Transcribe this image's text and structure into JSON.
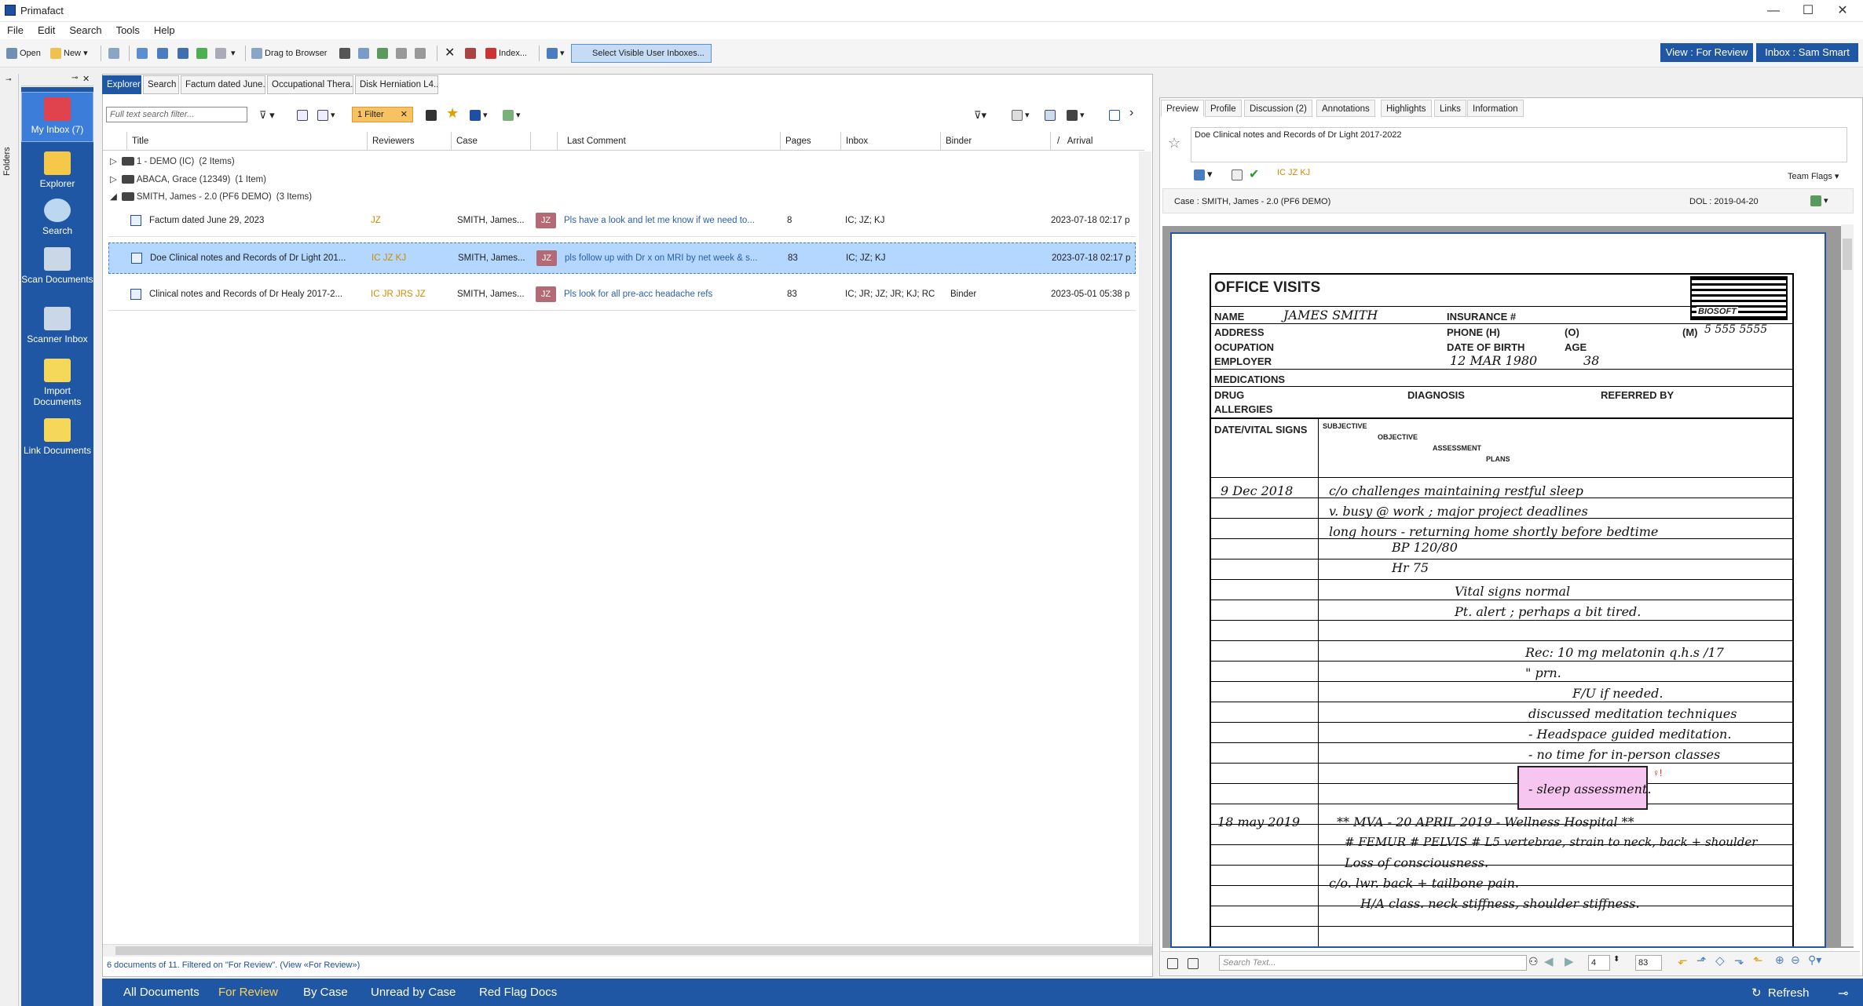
{
  "window": {
    "title": "Primafact",
    "min": "—",
    "max": "☐",
    "close": "✕"
  },
  "menu": [
    "File",
    "Edit",
    "Search",
    "Tools",
    "Help"
  ],
  "toolbar": {
    "open": "Open",
    "new": "New",
    "drag_to_browser": "Drag to Browser",
    "index": "Index...",
    "select_visible": "Select Visible User Inboxes..."
  },
  "header_buttons": {
    "view": "View : For Review",
    "inbox": "Inbox : Sam Smart"
  },
  "folders_label": "Folders",
  "nav": [
    {
      "label": "My Inbox (7)",
      "icon": "inbox-icon",
      "color": "#e0424e"
    },
    {
      "label": "Explorer",
      "icon": "folder-icon",
      "color": "#f5c84a"
    },
    {
      "label": "Search",
      "icon": "search-icon",
      "color": "#bcd7f0"
    },
    {
      "label": "Scan Documents",
      "icon": "scanner-icon",
      "color": "#c9d7e6"
    },
    {
      "label": "Scanner Inbox",
      "icon": "scanner-inbox-icon",
      "color": "#c9d7e6"
    },
    {
      "label": "Import Documents",
      "icon": "import-icon",
      "color": "#f5d75a"
    },
    {
      "label": "Link Documents",
      "icon": "link-icon",
      "color": "#f5d75a"
    }
  ],
  "tabs": [
    "Explorer",
    "Search",
    "Factum dated June...",
    "Occupational Thera...",
    "Disk Herniation L4..."
  ],
  "filter": {
    "placeholder": "Full text search filter...",
    "chip": "1 Filter"
  },
  "columns": [
    "Title",
    "Reviewers",
    "Case",
    "Last Comment",
    "Pages",
    "Inbox",
    "Binder",
    "Arrival"
  ],
  "groups": [
    {
      "name": "1 - DEMO (IC)",
      "count": "(2 Items)",
      "expanded": false
    },
    {
      "name": "ABACA, Grace (12349)",
      "count": "(1 Item)",
      "expanded": false
    },
    {
      "name": "SMITH, James - 2.0 (PF6 DEMO)",
      "count": "(3 Items)",
      "expanded": true
    }
  ],
  "rows": [
    {
      "title": "Factum dated June 29, 2023",
      "reviewers": "JZ",
      "case": "SMITH, James...",
      "badge": "JZ",
      "comment": "Pls have a look and let me know if we need to...",
      "pages": "8",
      "inbox": "IC; JZ; KJ",
      "binder": "",
      "arrival": "2023-07-18 02:17 p",
      "selected": false
    },
    {
      "title": "Doe Clinical notes and Records of Dr Light 201...",
      "reviewers": "IC JZ KJ",
      "case": "SMITH, James...",
      "badge": "JZ",
      "comment": "pls follow up with Dr x on MRI by net week  & s...",
      "pages": "83",
      "inbox": "IC; JZ; KJ",
      "binder": "",
      "arrival": "2023-07-18 02:17 p",
      "selected": true
    },
    {
      "title": "Clinical notes and Records of Dr Healy 2017-2...",
      "reviewers": "IC JR JRS JZ",
      "case": "SMITH, James...",
      "badge": "JZ",
      "comment": "Pls look for all pre-acc headache refs",
      "pages": "83",
      "inbox": "IC; JR; JZ; JR; KJ; RC",
      "binder": "Binder",
      "arrival": "2023-05-01 05:38 p",
      "selected": false
    }
  ],
  "status": "6 documents of 11.  Filtered on \"For Review\". (View «For Review»)",
  "bottom_tabs": [
    {
      "label": "All Documents",
      "active": false
    },
    {
      "label": "For Review",
      "active": true
    },
    {
      "label": "By Case",
      "active": false
    },
    {
      "label": "Unread by Case",
      "active": false
    },
    {
      "label": "Red Flag Docs",
      "active": false
    }
  ],
  "refresh": "Refresh",
  "right_tabs": [
    "Preview",
    "Profile",
    "Discussion (2)",
    "Annotations",
    "Highlights",
    "Links",
    "Information"
  ],
  "preview": {
    "doc_title": "Doe Clinical notes and Records of Dr Light 2017-2022",
    "reviewers": "IC JZ KJ",
    "team_flags": "Team Flags",
    "case": "Case : SMITH, James - 2.0 (PF6 DEMO)",
    "dol": "DOL : 2019-04-20",
    "search_placeholder": "Search Text...",
    "page": "4",
    "total_pages": "83"
  },
  "document": {
    "heading": "OFFICE VISITS",
    "logo": "BIOSOFT",
    "labels": {
      "name": "NAME",
      "insurance": "INSURANCE #",
      "address": "ADDRESS",
      "phone": "PHONE (H)",
      "phone_o": "(O)",
      "phone_m": "(M)",
      "occupation": "OCUPATION",
      "dob": "DATE OF BIRTH",
      "age": "AGE",
      "employer": "EMPLOYER",
      "medications": "MEDICATIONS",
      "drug": "DRUG",
      "diagnosis": "DIAGNOSIS",
      "referred": "REFERRED BY",
      "allergies": "ALLERGIES",
      "date_vital": "DATE/VITAL SIGNS",
      "subjective": "SUBJECTIVE",
      "objective": "OBJECTIVE",
      "assessment": "ASSESSMENT",
      "plans": "PLANS"
    },
    "hw_name": "JAMES SMITH",
    "hw_phone": "5 555 5555",
    "hw_dob": "12 MAR 1980",
    "hw_age": "38",
    "date1": "9 Dec 2018",
    "date2": "18 may 2019",
    "entries1": [
      "c/o challenges maintaining restful sleep",
      "v. busy @ work ; major project deadlines",
      "long hours - returning home shortly before bedtime",
      "BP 120/80",
      "Hr 75",
      "Vital signs normal",
      "Pt. alert ; perhaps a bit tired.",
      "Rec: 10 mg melatonin q.h.s /17",
      "\" prn.",
      "F/U if needed.",
      "discussed meditation techniques",
      "- Headspace guided meditation.",
      "- no time for in-person classes"
    ],
    "sticky": "- sleep assessment.",
    "entries2": [
      "** MVA - 20 APRIL 2019 - Wellness Hospital **",
      "# FEMUR # PELVIS # L5 vertebrae, strain to neck, back + shoulder",
      "Loss of consciousness.",
      "c/o. lwr. back + tailbone pain.",
      "H/A class. neck stiffness, shoulder stiffness."
    ]
  }
}
